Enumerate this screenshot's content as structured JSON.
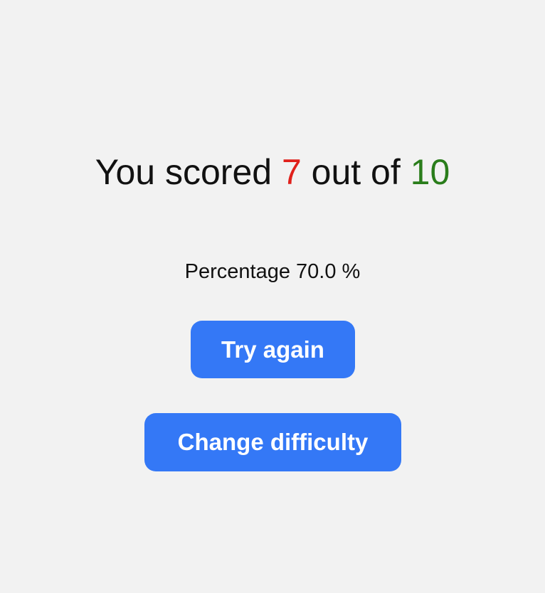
{
  "result": {
    "prefix": "You scored ",
    "correct": "7",
    "middle": " out of ",
    "total": "10",
    "correct_color": "#e0201b",
    "total_color": "#2a7d1b"
  },
  "percentage": {
    "label": "Percentage",
    "value": "70.0",
    "unit": "%"
  },
  "actions": {
    "try_again_label": "Try again",
    "change_difficulty_label": "Change difficulty",
    "button_color": "#3478f6"
  }
}
